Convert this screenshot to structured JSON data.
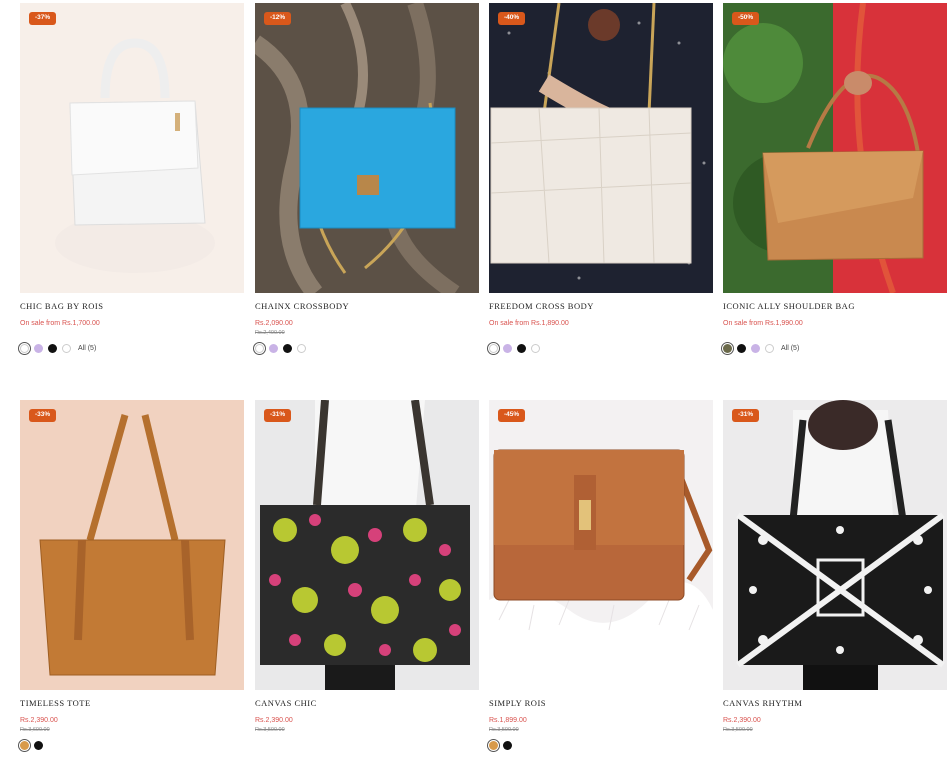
{
  "colors": {
    "accent": "#d9581b",
    "sale": "#d9534f"
  },
  "products": [
    {
      "badge": "-37%",
      "name": "CHIC BAG BY ROIS",
      "price": "On sale from Rs.1,700.00",
      "compare": "",
      "swatches": [
        "#ffffff",
        "#c9b3e6",
        "#111111",
        "#ffffff"
      ],
      "all": "All (5)"
    },
    {
      "badge": "-12%",
      "name": "CHAINX CROSSBODY",
      "price": "Rs.2,090.00",
      "compare": "Rs.2,400.00",
      "swatches": [
        "#ffffff",
        "#c9b3e6",
        "#111111",
        "#ffffff"
      ],
      "all": ""
    },
    {
      "badge": "-40%",
      "name": "FREEDOM CROSS BODY",
      "price": "On sale from Rs.1,890.00",
      "compare": "",
      "swatches": [
        "#ffffff",
        "#c9b3e6",
        "#111111",
        "#ffffff"
      ],
      "all": ""
    },
    {
      "badge": "-50%",
      "name": "ICONIC ALLY SHOULDER BAG",
      "price": "On sale from Rs.1,990.00",
      "compare": "",
      "swatches": [
        "#6b6a4a",
        "#111111",
        "#c9b3e6",
        "#ffffff"
      ],
      "all": "All (5)"
    },
    {
      "badge": "-33%",
      "name": "TIMELESS TOTE",
      "price": "Rs.2,390.00",
      "compare": "Rs.3,600.00",
      "swatches": [
        "#d89a4a",
        "#111111"
      ],
      "all": ""
    },
    {
      "badge": "-31%",
      "name": "CANVAS CHIC",
      "price": "Rs.2,390.00",
      "compare": "Rs.3,500.00",
      "swatches": [],
      "all": ""
    },
    {
      "badge": "-45%",
      "name": "SIMPLY ROIS",
      "price": "Rs.1,899.00",
      "compare": "Rs.3,500.00",
      "swatches": [
        "#d89a4a",
        "#111111"
      ],
      "all": ""
    },
    {
      "badge": "-31%",
      "name": "CANVAS RHYTHM",
      "price": "Rs.2,390.00",
      "compare": "Rs.3,500.00",
      "swatches": [],
      "all": ""
    }
  ]
}
